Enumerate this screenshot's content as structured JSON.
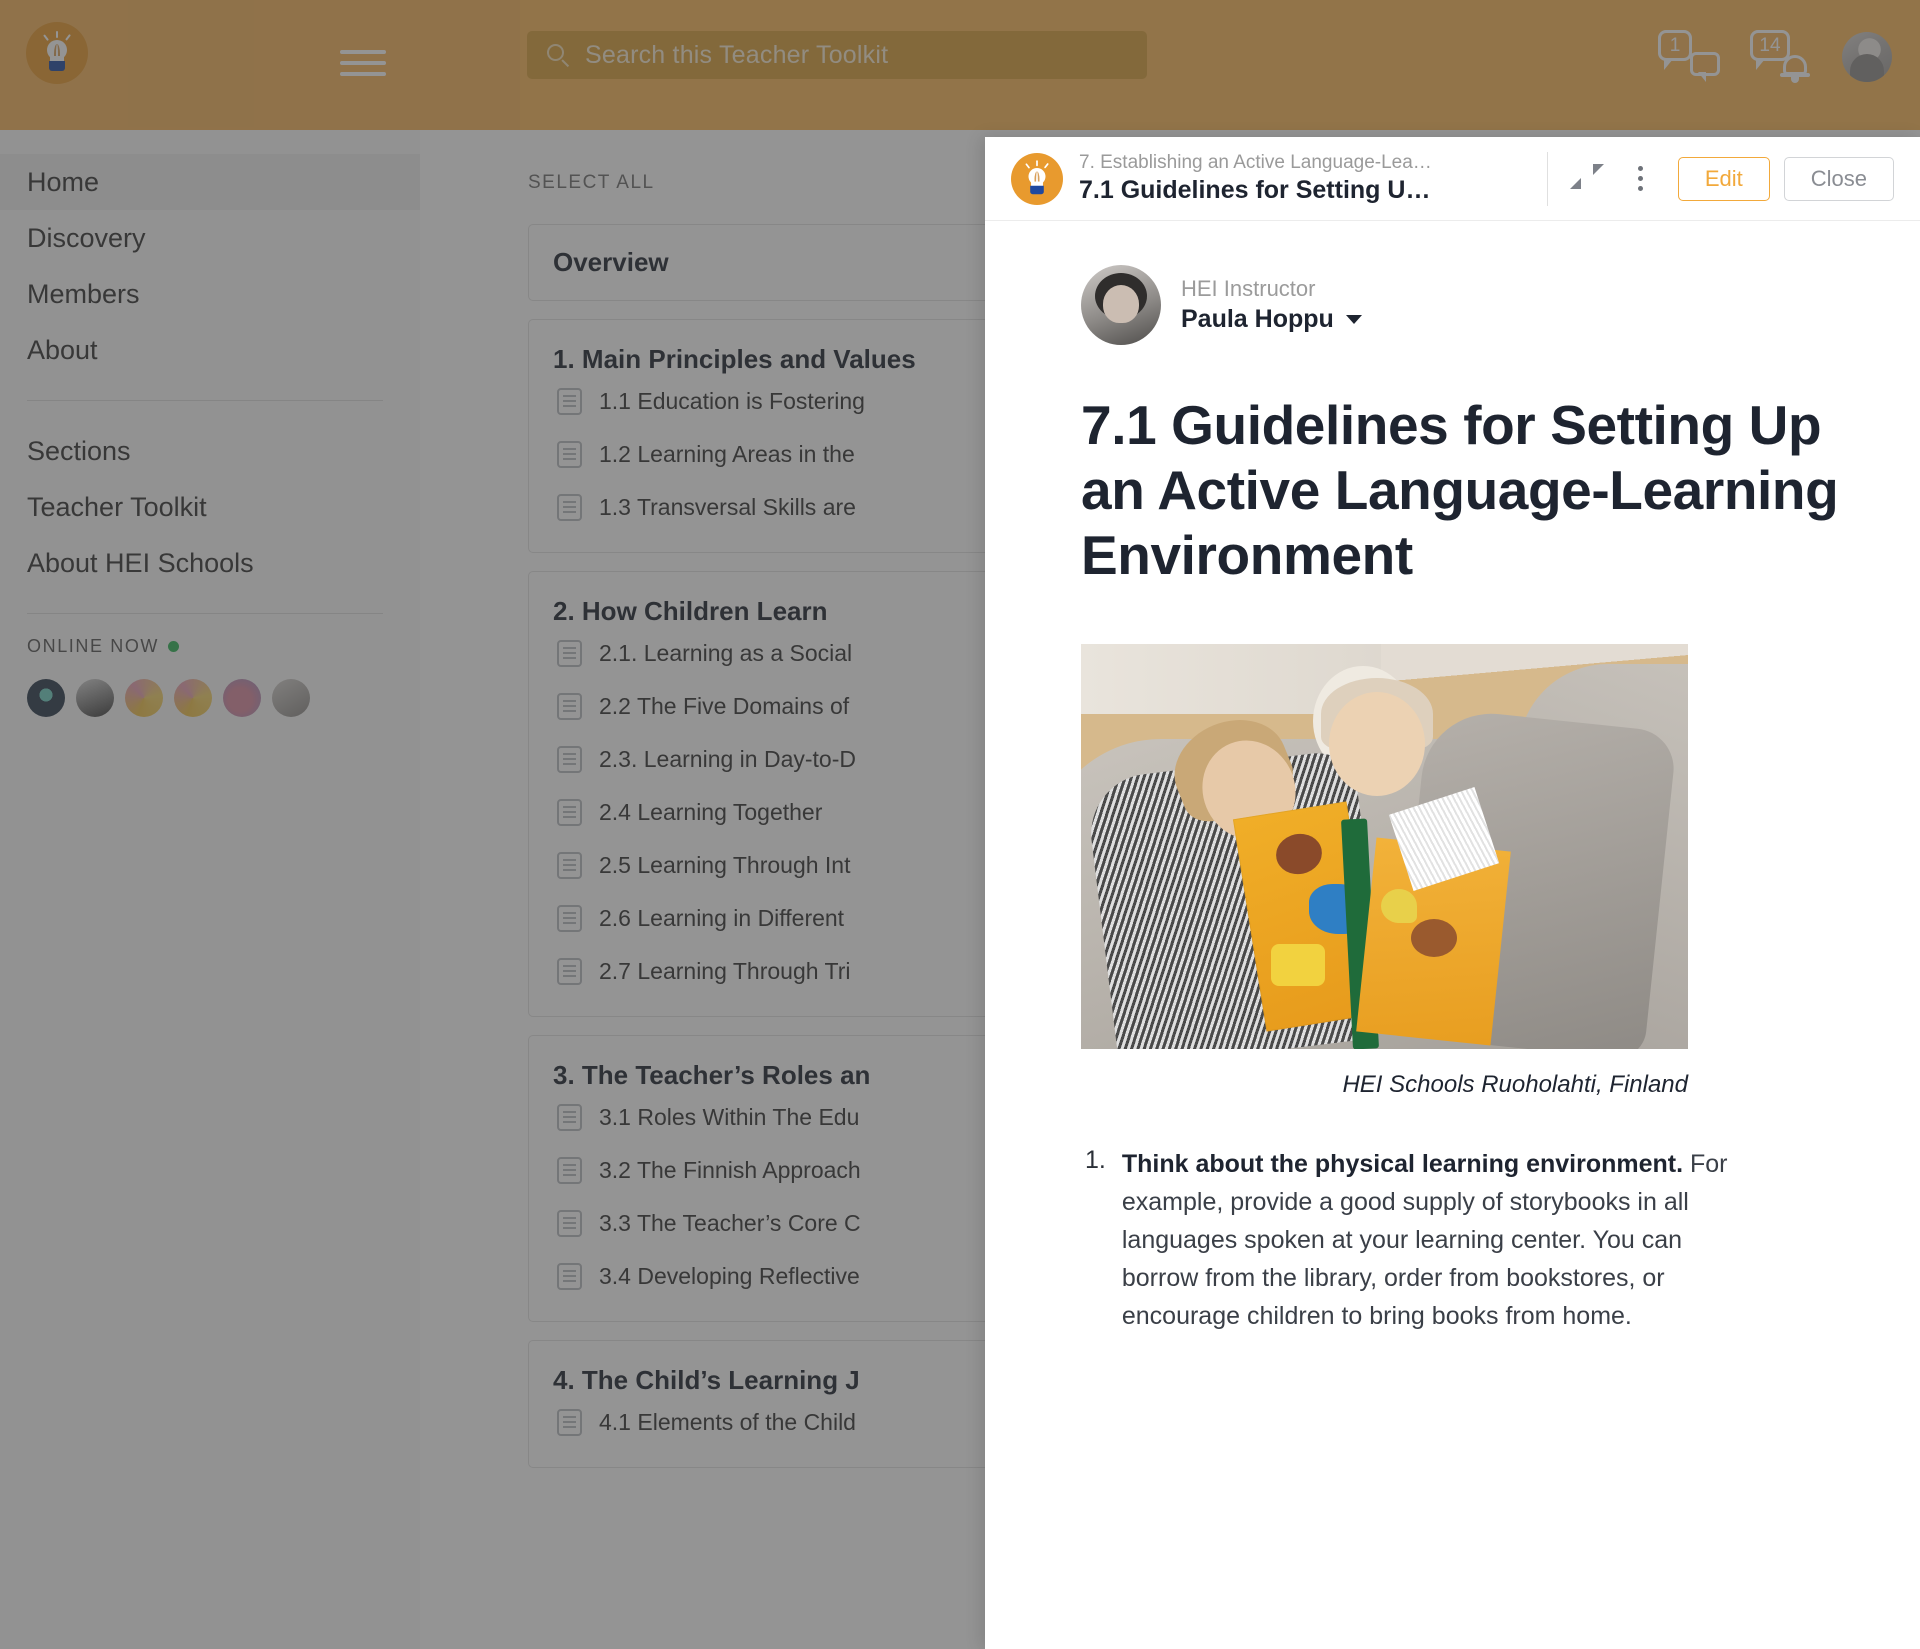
{
  "topbar": {
    "logo_icon": "lightbulb-logo-icon",
    "menu_icon": "hamburger-menu-icon",
    "search": {
      "icon": "search-icon",
      "placeholder": "Search this Teacher Toolkit",
      "value": ""
    },
    "messages": {
      "icon": "chat-bubble-icon",
      "count": "1"
    },
    "notifications": {
      "icon": "bell-icon",
      "count": "14"
    },
    "avatar": "user-avatar"
  },
  "sidebar": {
    "primary": [
      {
        "label": "Home",
        "active": true
      },
      {
        "label": "Discovery",
        "active": false
      },
      {
        "label": "Members",
        "active": false
      },
      {
        "label": "About",
        "active": false
      }
    ],
    "secondary": [
      {
        "label": "Sections"
      },
      {
        "label": "Teacher Toolkit"
      },
      {
        "label": "About HEI Schools"
      }
    ],
    "online": {
      "label": "ONLINE NOW",
      "status_dot_color": "#2fb457",
      "avatar_count": 6
    }
  },
  "main": {
    "select_all": "SELECT ALL",
    "cards": [
      {
        "title": "Overview",
        "items": []
      },
      {
        "title": "1. Main Principles and Values",
        "items": [
          "1.1 Education is Fostering",
          "1.2 Learning Areas in the",
          "1.3 Transversal Skills are"
        ]
      },
      {
        "title": "2. How Children Learn",
        "items": [
          "2.1. Learning as a Social",
          "2.2 The Five Domains of",
          "2.3. Learning in Day-to-D",
          "2.4 Learning Together",
          "2.5 Learning Through Int",
          "2.6 Learning in Different",
          "2.7 Learning Through Tri"
        ]
      },
      {
        "title": "3. The Teacher’s Roles an",
        "items": [
          "3.1 Roles Within The Edu",
          "3.2 The Finnish Approach",
          "3.3 The Teacher’s Core C",
          "3.4 Developing Reflective"
        ]
      },
      {
        "title": "4. The Child’s Learning J",
        "items": [
          "4.1 Elements of the Child"
        ]
      }
    ]
  },
  "modal": {
    "logo_icon": "lightbulb-logo-icon",
    "breadcrumb": "7. Establishing an Active Language-Lea…",
    "title": "7.1 Guidelines for Setting U…",
    "expand_icon": "expand-collapse-icon",
    "more_icon": "kebab-menu-icon",
    "edit_label": "Edit",
    "close_label": "Close",
    "accent_color": "#f2a93b",
    "author": {
      "role": "HEI Instructor",
      "name": "Paula Hoppu",
      "dropdown_icon": "chevron-down-icon"
    },
    "article": {
      "title": "7.1 Guidelines for Setting Up an Active Language-Learning Environment",
      "image_alt": "Two children lying on a grey sofa reading a picture book together",
      "caption": "HEI Schools Ruoholahti, Finland",
      "list": [
        {
          "number": "1.",
          "lead": "Think about the physical learning environment.",
          "text": " For example, provide a good supply of storybooks in all languages spoken at your learning center. You can borrow from the library, order from bookstores, or encourage children to bring books from home."
        }
      ]
    }
  }
}
